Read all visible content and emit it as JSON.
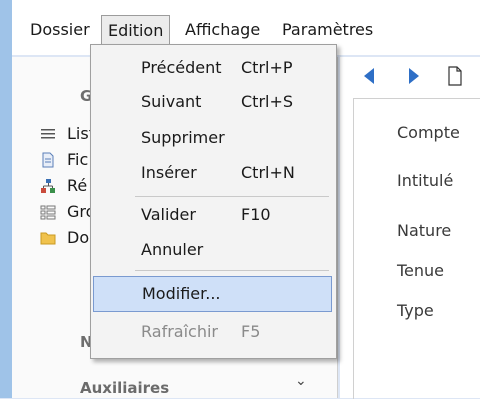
{
  "menubar": {
    "dossier": "Dossier",
    "edition": "Edition",
    "affichage": "Affichage",
    "parametres": "Paramètres"
  },
  "edition_menu": {
    "precedent": {
      "label": "Précédent",
      "shortcut": "Ctrl+P"
    },
    "suivant": {
      "label": "Suivant",
      "shortcut": "Ctrl+S"
    },
    "supprimer": {
      "label": "Supprimer"
    },
    "inserer": {
      "label": "Insérer",
      "shortcut": "Ctrl+N"
    },
    "valider": {
      "label": "Valider",
      "shortcut": "F10"
    },
    "annuler": {
      "label": "Annuler"
    },
    "modifier": {
      "label": "Modifier..."
    },
    "rafraichir": {
      "label": "Rafraîchir",
      "shortcut": "F5",
      "disabled": true
    }
  },
  "left_panel": {
    "header_fragment": "G",
    "tree": [
      {
        "label": "List",
        "icon": "list-icon"
      },
      {
        "label": "Fic",
        "icon": "document-icon"
      },
      {
        "label": "Ré",
        "icon": "hierarchy-icon"
      },
      {
        "label": "Gro",
        "icon": "grid-icon"
      },
      {
        "label": "Do",
        "icon": "folder-icon"
      }
    ],
    "footer_fragment": "N",
    "auxiliaires": "Auxiliaires"
  },
  "form_labels": {
    "compte": "Compte",
    "intitule": "Intitulé",
    "nature": "Nature",
    "tenue": "Tenue",
    "type": "Type"
  },
  "colors": {
    "accent": "#2e6fc6",
    "highlight_bg": "#cfe0f8",
    "highlight_border": "#7a9ad0"
  }
}
